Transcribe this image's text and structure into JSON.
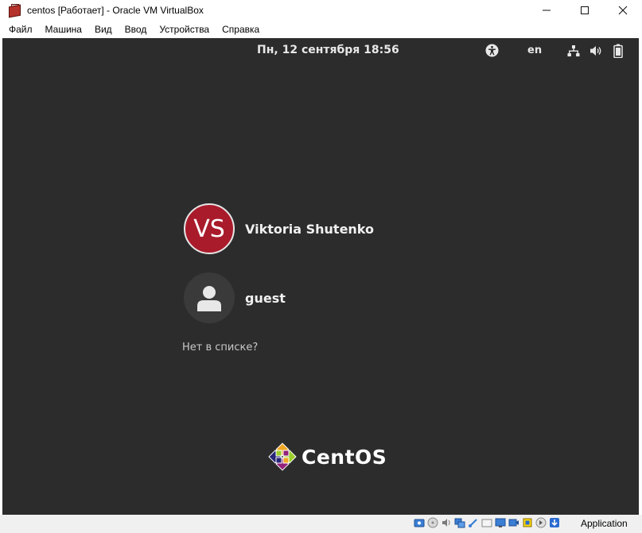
{
  "window": {
    "title": "centos [Работает] - Oracle VM VirtualBox",
    "minimize_glyph": "—",
    "maximize_glyph": "☐",
    "close_glyph": "✕"
  },
  "menu": {
    "items": [
      "Файл",
      "Машина",
      "Вид",
      "Ввод",
      "Устройства",
      "Справка"
    ]
  },
  "topbar": {
    "datetime": "Пн, 12 сентября  18:56",
    "language": "en",
    "icons": [
      "accessibility-icon",
      "network-icon",
      "volume-icon",
      "battery-icon"
    ]
  },
  "users": [
    {
      "initials": "VS",
      "name": "Viktoria Shutenko",
      "avatar_color": "#a91b2b"
    },
    {
      "initials": "",
      "name": "guest",
      "avatar_color": "#3a3a3a"
    }
  ],
  "not_listed_link": "Нет в списке?",
  "logo_text": "CentOS",
  "statusbar": {
    "host_key_label": "Application",
    "icons": [
      "hard-disk-icon",
      "optical-drive-icon",
      "audio-icon",
      "network-adapter-icon",
      "usb-icon",
      "shared-folders-icon",
      "display-icon",
      "video-capture-icon",
      "cpu-icon",
      "mouse-integration-icon",
      "keyboard-capture-icon"
    ]
  },
  "colors": {
    "screen_background": "#2c2c2c",
    "vs_avatar": "#a91b2b",
    "statusbar_background": "#f0f0f0"
  }
}
